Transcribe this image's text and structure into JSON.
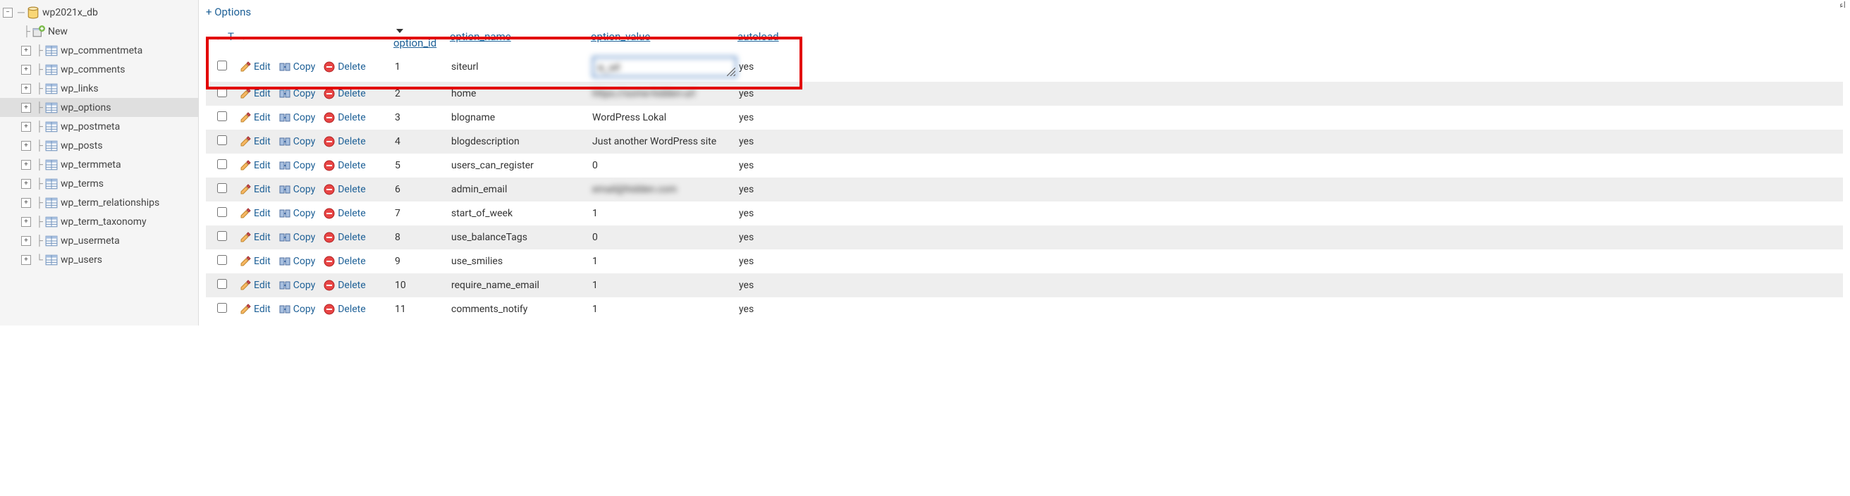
{
  "sidebar": {
    "database": "wp2021x_db",
    "new_label": "New",
    "tables": [
      "wp_commentmeta",
      "wp_comments",
      "wp_links",
      "wp_options",
      "wp_postmeta",
      "wp_posts",
      "wp_termmeta",
      "wp_terms",
      "wp_term_relationships",
      "wp_term_taxonomy",
      "wp_usermeta",
      "wp_users"
    ],
    "selected_table": "wp_options"
  },
  "main": {
    "options_link": "+ Options",
    "sort_arrows": "←T→",
    "headers": {
      "option_id": "option_id",
      "option_name": "option_name",
      "option_value": "option_value",
      "autoload": "autoload"
    },
    "actions": {
      "edit": "Edit",
      "copy": "Copy",
      "delete": "Delete"
    },
    "rows": [
      {
        "option_id": "1",
        "option_name": "siteurl",
        "option_value": "blurred_edit",
        "autoload": "yes",
        "edit_value": "a_url"
      },
      {
        "option_id": "2",
        "option_name": "home",
        "option_value": "blurred_text",
        "autoload": "yes"
      },
      {
        "option_id": "3",
        "option_name": "blogname",
        "option_value": "WordPress Lokal",
        "autoload": "yes"
      },
      {
        "option_id": "4",
        "option_name": "blogdescription",
        "option_value": "Just another WordPress site",
        "autoload": "yes"
      },
      {
        "option_id": "5",
        "option_name": "users_can_register",
        "option_value": "0",
        "autoload": "yes"
      },
      {
        "option_id": "6",
        "option_name": "admin_email",
        "option_value": "blurred_email",
        "autoload": "yes"
      },
      {
        "option_id": "7",
        "option_name": "start_of_week",
        "option_value": "1",
        "autoload": "yes"
      },
      {
        "option_id": "8",
        "option_name": "use_balanceTags",
        "option_value": "0",
        "autoload": "yes"
      },
      {
        "option_id": "9",
        "option_name": "use_smilies",
        "option_value": "1",
        "autoload": "yes"
      },
      {
        "option_id": "10",
        "option_name": "require_name_email",
        "option_value": "1",
        "autoload": "yes"
      },
      {
        "option_id": "11",
        "option_name": "comments_notify",
        "option_value": "1",
        "autoload": "yes"
      }
    ]
  },
  "corner_label": "اء"
}
